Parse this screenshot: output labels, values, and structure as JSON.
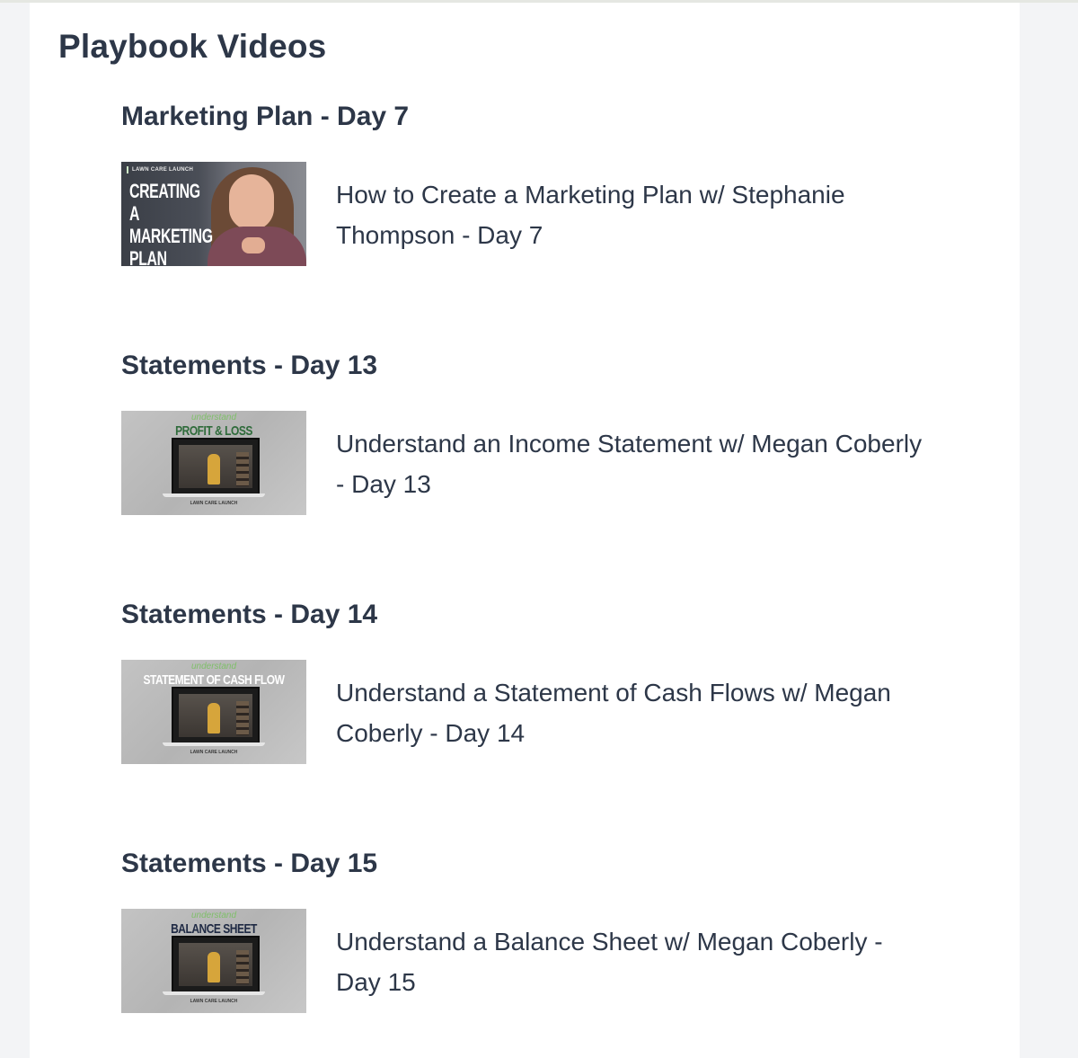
{
  "page": {
    "title": "Playbook Videos"
  },
  "sections": [
    {
      "heading": "Marketing Plan - Day 7",
      "video": {
        "title": "How to Create a Marketing Plan w/ Stephanie Thompson - Day 7",
        "thumbnail": {
          "brand": "LAWN CARE LAUNCH",
          "text_line_1": "CREATING A",
          "text_line_2": "MARKETING",
          "text_line_3": "PLAN"
        }
      }
    },
    {
      "heading": "Statements - Day 13",
      "video": {
        "title": "Understand an Income Statement w/ Megan Coberly - Day 13",
        "thumbnail": {
          "script": "understand",
          "label": "PROFIT & LOSS",
          "label_color": "#2e6b3a",
          "brand": "LAWN CARE LAUNCH"
        }
      }
    },
    {
      "heading": "Statements - Day 14",
      "video": {
        "title": "Understand a Statement of Cash Flows w/ Megan Coberly - Day 14",
        "thumbnail": {
          "script": "understand",
          "label": "STATEMENT OF CASH FLOW",
          "label_color": "#ffffff",
          "brand": "LAWN CARE LAUNCH"
        }
      }
    },
    {
      "heading": "Statements - Day 15",
      "video": {
        "title": "Understand a Balance Sheet w/ Megan Coberly - Day 15",
        "thumbnail": {
          "script": "understand",
          "label": "BALANCE SHEET",
          "label_color": "#1f2a44",
          "brand": "LAWN CARE LAUNCH"
        }
      }
    }
  ],
  "colors": {
    "text": "#2d3748",
    "panel": "#ffffff",
    "background": "#f3f4f6"
  }
}
